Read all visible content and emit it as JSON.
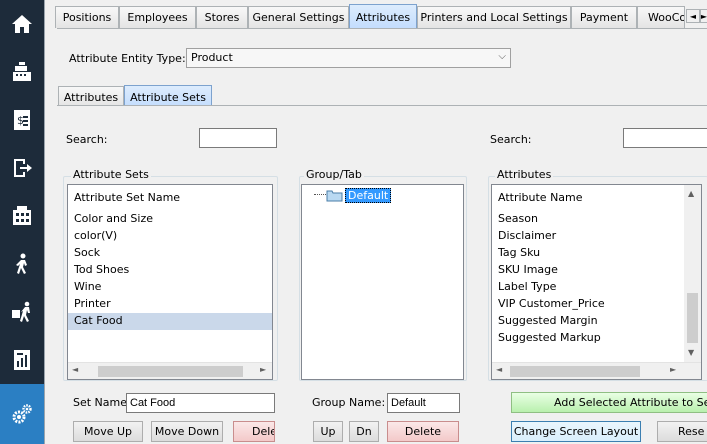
{
  "nav": {
    "items": [
      {
        "icon": "home-icon"
      },
      {
        "icon": "cash-register-icon"
      },
      {
        "icon": "invoice-icon"
      },
      {
        "icon": "sign-out-icon"
      },
      {
        "icon": "inventory-grid-icon"
      },
      {
        "icon": "walking-person-icon"
      },
      {
        "icon": "delivery-icon"
      },
      {
        "icon": "reports-icon"
      },
      {
        "icon": "settings-gears-icon"
      }
    ],
    "active_index": 8,
    "colors": {
      "background": "#1d2b3a",
      "active": "#2b7fc3",
      "icon": "#ffffff"
    }
  },
  "top_tabs": [
    {
      "label": "Positions"
    },
    {
      "label": "Employees"
    },
    {
      "label": "Stores"
    },
    {
      "label": "General Settings"
    },
    {
      "label": "Attributes",
      "active": true
    },
    {
      "label": "Printers and Local Settings"
    },
    {
      "label": "Payment"
    },
    {
      "label": "WooCo"
    }
  ],
  "tab_scroll": {
    "left": "◄",
    "right": "►"
  },
  "entity_type": {
    "label": "Attribute Entity Type:",
    "value": "Product"
  },
  "sub_tabs": [
    {
      "label": "Attributes"
    },
    {
      "label": "Attribute Sets",
      "active": true
    }
  ],
  "search_left": {
    "label": "Search:",
    "value": ""
  },
  "search_right": {
    "label": "Search:",
    "value": ""
  },
  "attribute_sets": {
    "title": "Attribute Sets",
    "header": "Attribute Set Name",
    "items": [
      "Color and Size",
      "color(V)",
      "Sock",
      "Tod Shoes",
      "Wine",
      "Printer",
      "Cat Food"
    ],
    "selected": "Cat Food"
  },
  "group_tab": {
    "title": "Group/Tab",
    "tree_items": [
      "Default"
    ]
  },
  "attributes": {
    "title": "Attributes",
    "header": "Attribute Name",
    "items": [
      "Season",
      "Disclaimer",
      "Tag Sku",
      "SKU Image",
      "Label Type",
      "VIP Customer_Price",
      "Suggested Margin",
      "Suggested Markup"
    ]
  },
  "set_name": {
    "label": "Set Name:",
    "value": "Cat Food"
  },
  "group_name": {
    "label": "Group Name:",
    "value": "Default"
  },
  "buttons": {
    "move_up": "Move Up",
    "move_down": "Move Down",
    "delete_set": "Dele",
    "up": "Up",
    "dn": "Dn",
    "delete_group": "Delete",
    "add_selected": "Add Selected Attribute to Selec",
    "change_layout": "Change Screen Layout",
    "reset": "Rese"
  },
  "scroll_arrows": {
    "left": "◄",
    "right": "►",
    "up": "▲",
    "down": "▼"
  }
}
